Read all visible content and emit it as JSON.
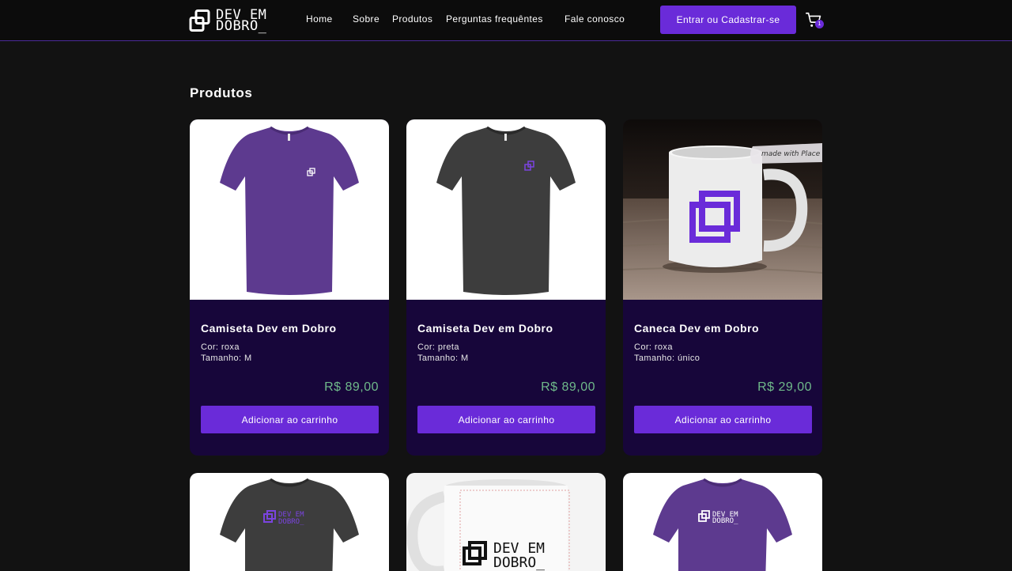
{
  "header": {
    "logo_line1": "DEV EM",
    "logo_line2": "DOBRO_",
    "nav": [
      {
        "label": "Home"
      },
      {
        "label": "Sobre"
      },
      {
        "label": "Produtos"
      },
      {
        "label": "Perguntas frequêntes"
      },
      {
        "label": "Fale conosco"
      }
    ],
    "login_label": "Entrar ou Cadastrar-se",
    "cart_count": "1",
    "accent": "#6a2bd9"
  },
  "main": {
    "title": "Produtos",
    "products": [
      {
        "name": "Camiseta Dev em Dobro",
        "color": "Cor: roxa",
        "size": "Tamanho: M",
        "price": "R$ 89,00",
        "button": "Adicionar ao carrinho",
        "image": "purple-tshirt"
      },
      {
        "name": "Camiseta Dev em Dobro",
        "color": "Cor: preta",
        "size": "Tamanho: M",
        "price": "R$ 89,00",
        "button": "Adicionar ao carrinho",
        "image": "black-tshirt"
      },
      {
        "name": "Caneca Dev em Dobro",
        "color": "Cor: roxa",
        "size": "Tamanho: único",
        "price": "R$ 29,00",
        "button": "Adicionar ao carrinho",
        "image": "purple-logo-mug",
        "watermark": "made with Place"
      }
    ],
    "more_products": [
      {
        "image": "black-tshirt-front-logo",
        "logo_line1": "DEV EM",
        "logo_line2": "DOBRO_"
      },
      {
        "image": "white-mug-logo",
        "logo_line1": "DEV EM",
        "logo_line2": "DOBRO_"
      },
      {
        "image": "purple-tshirt-front-logo",
        "logo_line1": "DEV EM",
        "logo_line2": "DOBRO_"
      }
    ]
  }
}
